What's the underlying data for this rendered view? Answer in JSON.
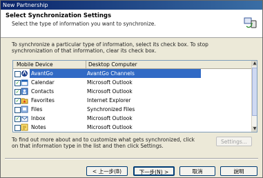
{
  "window": {
    "title": "New Partnership"
  },
  "header": {
    "title": "Select Synchronization Settings",
    "subtitle": "Select the type of information you want to synchronize."
  },
  "description": "To synchronize a particular type of information, select its check box. To stop synchronization of that information, clear its check box.",
  "list": {
    "columns": [
      "Mobile Device",
      "Desktop Computer"
    ],
    "rows": [
      {
        "device": "AvantGo",
        "desktop": "AvantGo Channels",
        "checked": false,
        "icon": "avantgo-icon",
        "selected": true
      },
      {
        "device": "Calendar",
        "desktop": "Microsoft Outlook",
        "checked": true,
        "icon": "calendar-icon",
        "selected": false
      },
      {
        "device": "Contacts",
        "desktop": "Microsoft Outlook",
        "checked": true,
        "icon": "contacts-icon",
        "selected": false
      },
      {
        "device": "Favorites",
        "desktop": "Internet Explorer",
        "checked": true,
        "icon": "favorites-icon",
        "selected": false
      },
      {
        "device": "Files",
        "desktop": "Synchronized Files",
        "checked": false,
        "icon": "files-icon",
        "selected": false
      },
      {
        "device": "Inbox",
        "desktop": "Microsoft Outlook",
        "checked": true,
        "icon": "inbox-icon",
        "selected": false
      },
      {
        "device": "Notes",
        "desktop": "Microsoft Outlook",
        "checked": false,
        "icon": "notes-icon",
        "selected": false
      }
    ]
  },
  "hint": "To find out more about and to customize what gets synchronized, click on that information type in the list and then click Settings.",
  "buttons": {
    "settings": "Settings...",
    "back": "< 上一步(B)",
    "next": "下一步(N) >",
    "cancel": "取消",
    "help": "說明"
  },
  "colors": {
    "selection": "#316ac5",
    "titlebar": "#0a246a",
    "dialog_bg": "#ece9d8"
  }
}
